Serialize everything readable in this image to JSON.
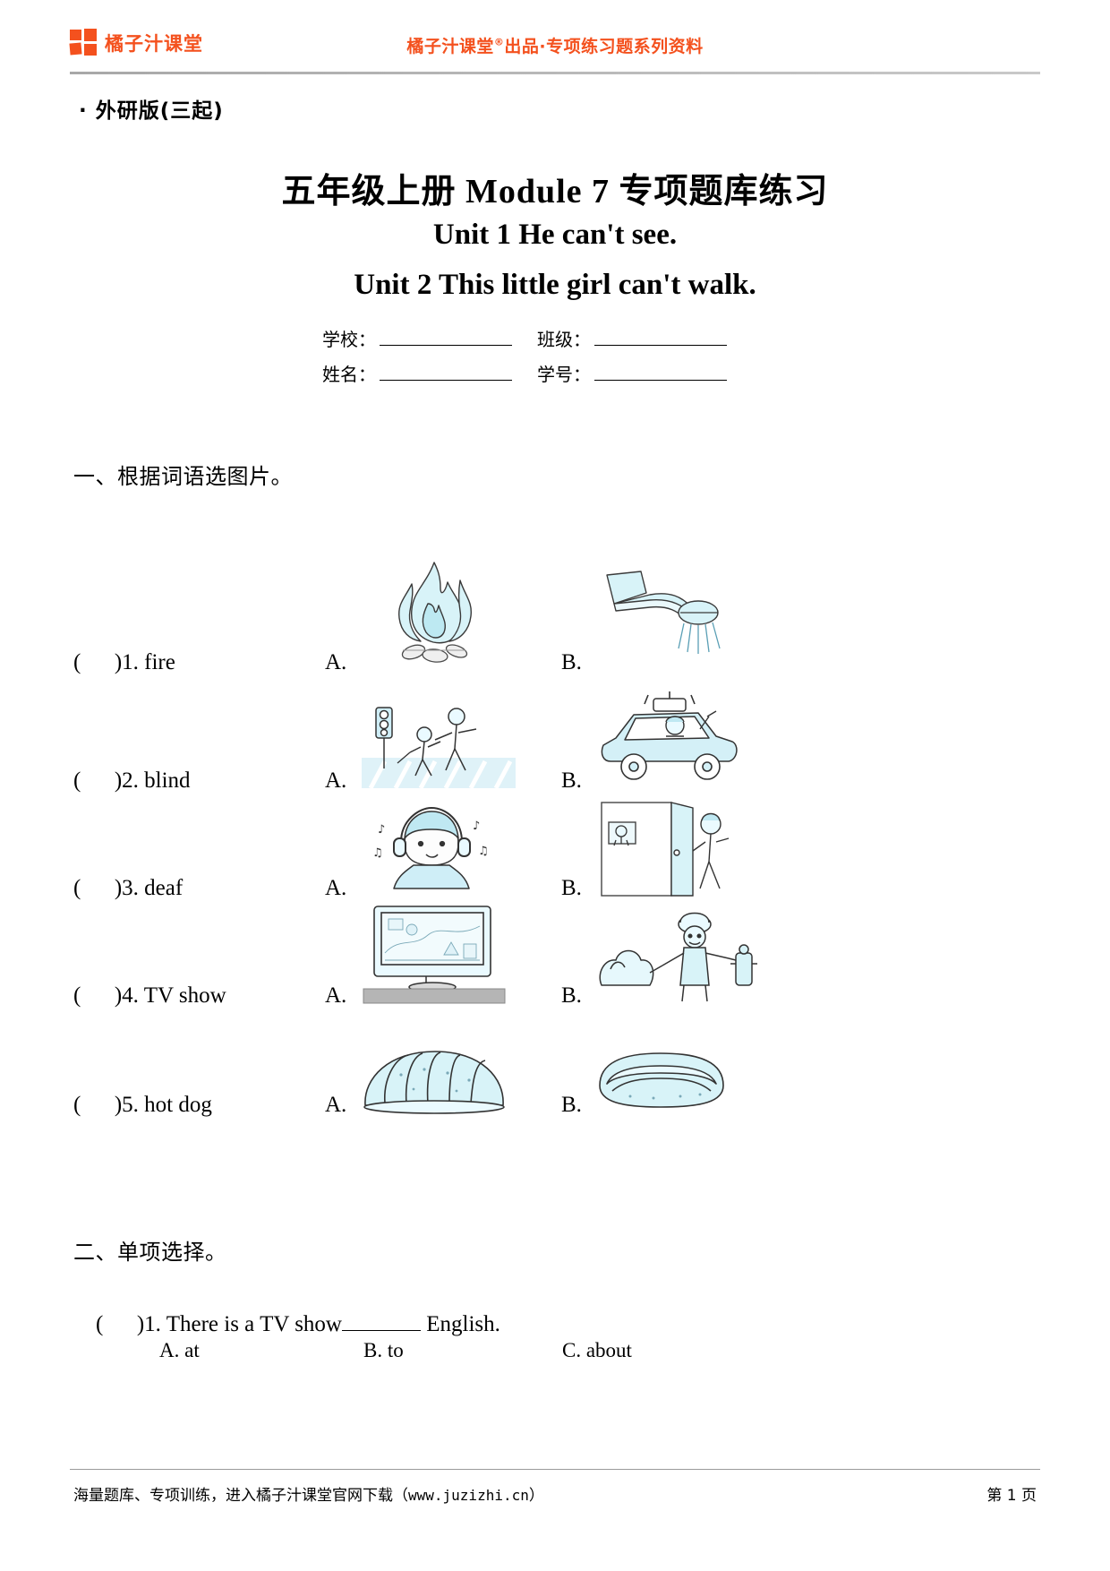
{
  "header": {
    "brand_name": "橘子汁课堂",
    "logo_icon": "four-squares-logo-icon",
    "slogan_prefix": "橘子汁课堂",
    "slogan_mark": "®",
    "slogan_suffix": "出品·专项练习题系列资料",
    "accent_color": "#f4511e"
  },
  "edition": "· 外研版(三起)",
  "title": {
    "main": "五年级上册 Module 7 专项题库练习",
    "unit1": "Unit 1 He can't see.",
    "unit2": "Unit 2 This little girl can't walk."
  },
  "info_fields": [
    [
      {
        "label": "学校：",
        "value": ""
      },
      {
        "label": "班级：",
        "value": ""
      }
    ],
    [
      {
        "label": "姓名：",
        "value": ""
      },
      {
        "label": "学号：",
        "value": ""
      }
    ]
  ],
  "sections": [
    {
      "heading": "一、根据词语选图片。",
      "items": [
        {
          "bracket": "(      )",
          "number": "1.",
          "word": "fire",
          "a_label": "A.",
          "b_label": "B.",
          "a_pic": "campfire-flame-picture",
          "b_pic": "shower-head-picture"
        },
        {
          "bracket": "(      )",
          "number": "2.",
          "word": "blind",
          "a_label": "A.",
          "b_label": "B.",
          "a_pic": "crosswalk-traffic-light-picture",
          "b_pic": "taxi-driver-car-picture"
        },
        {
          "bracket": "(      )",
          "number": "3.",
          "word": "deaf",
          "a_label": "A.",
          "b_label": "B.",
          "a_pic": "girl-wearing-headphones-picture",
          "b_pic": "boy-at-door-picture"
        },
        {
          "bracket": "(      )",
          "number": "4.",
          "word": "TV show",
          "a_label": "A.",
          "b_label": "B.",
          "a_pic": "television-screen-picture",
          "b_pic": "firefighter-hose-picture"
        },
        {
          "bracket": "(      )",
          "number": "5.",
          "word": "hot dog",
          "a_label": "A.",
          "b_label": "B.",
          "a_pic": "bread-loaf-picture",
          "b_pic": "hot-dog-sandwich-picture"
        }
      ]
    },
    {
      "heading": "二、单项选择。",
      "items": [
        {
          "bracket": "(      )",
          "number": "1.",
          "stem_before": "There is a TV show",
          "stem_after": " English.",
          "options": [
            "A. at",
            "B. to",
            "C. about"
          ]
        }
      ]
    }
  ],
  "footer": {
    "left_text_before": "海量题库、专项训练，进入橘子汁课堂官网下载（",
    "left_url": "www.juzizhi.cn",
    "left_text_after": "）",
    "page_label": "第 1 页"
  }
}
